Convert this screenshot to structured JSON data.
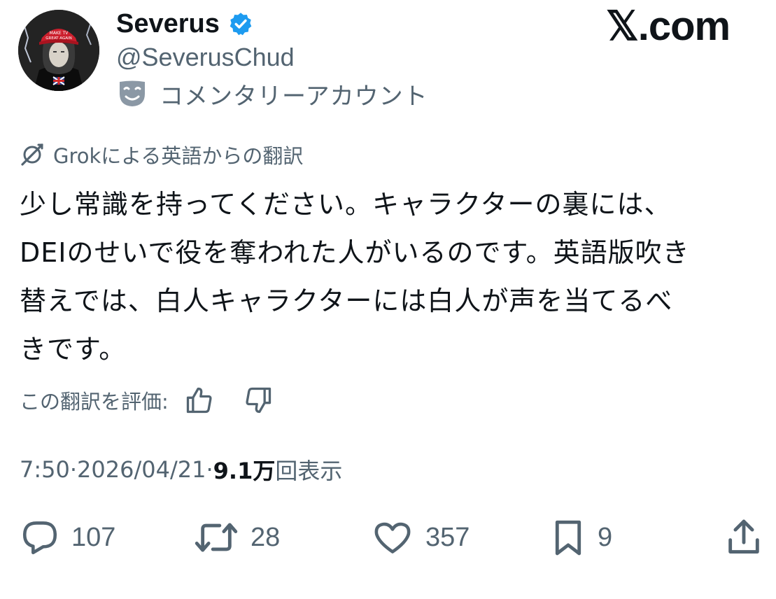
{
  "brand": "𝕏.com",
  "author": {
    "name": "Severus",
    "handle": "@SeverusChud",
    "account_label": "コメンタリーアカウント",
    "avatar_cap_text": "MAKE TV GREAT AGAIN"
  },
  "translation": {
    "label": "Grokによる英語からの翻訳",
    "rate_label": "この翻訳を評価:"
  },
  "post": {
    "line1": "少し常識を持ってください。キャラクターの裏には、",
    "line2": "DEIのせいで役を奪われた人がいるのです。英語版吹き",
    "line3": "替えでは、白人キャラクターには白人が声を当てるべ",
    "line4": "きです。"
  },
  "meta": {
    "time": "7:50",
    "sep1": " · ",
    "date": "2026/04/21",
    "sep2": " · ",
    "views": "9.1万",
    "views_suffix": "回表示"
  },
  "actions": {
    "replies": "107",
    "reposts": "28",
    "likes": "357",
    "bookmarks": "9"
  },
  "colors": {
    "text": "#0f1419",
    "secondary": "#536471",
    "verified": "#1d9bf0"
  }
}
